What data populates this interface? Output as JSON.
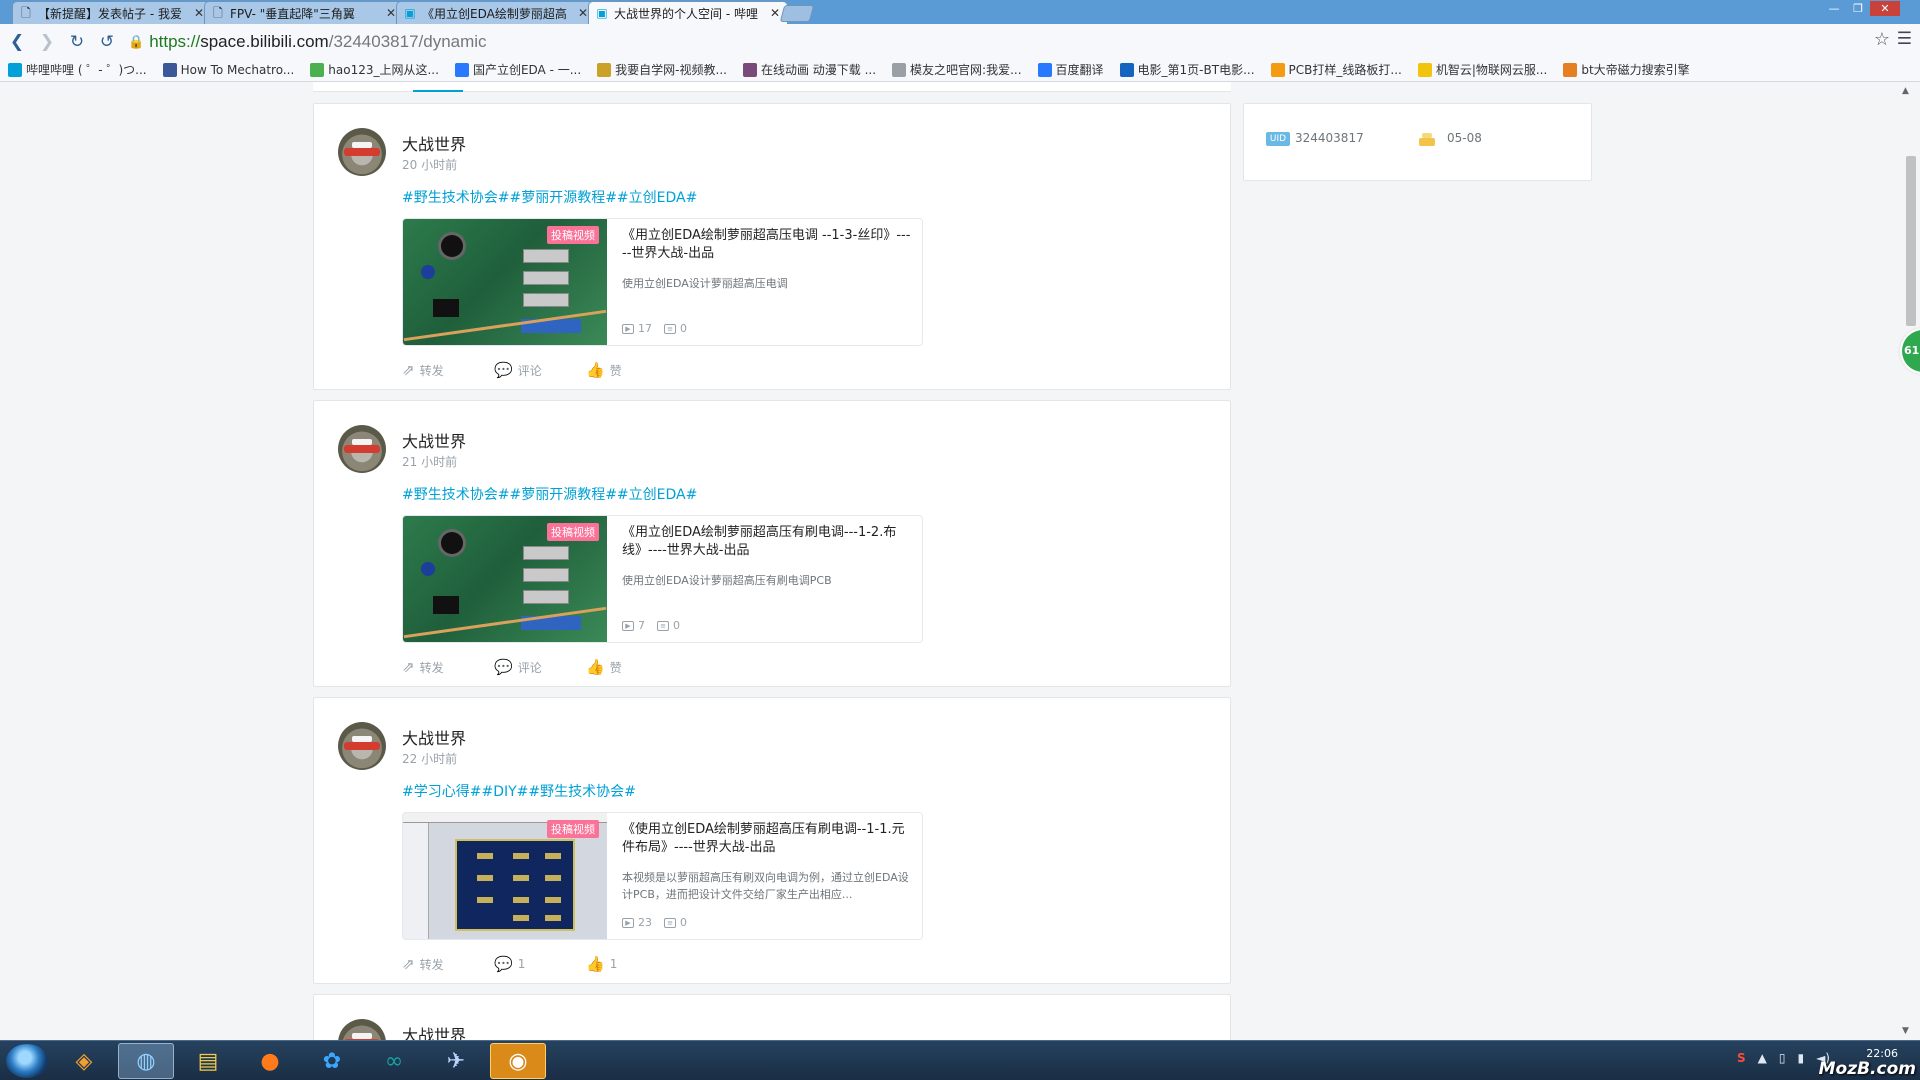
{
  "browser": {
    "tabs": [
      {
        "title": "【新提醒】发表帖子 - 我爱",
        "icon": "page-icon"
      },
      {
        "title": "FPV- \"垂直起降\"三角翼",
        "icon": "page-icon"
      },
      {
        "title": "《用立创EDA绘制萝丽超高",
        "icon": "bilibili-icon"
      },
      {
        "title": "大战世界的个人空间 - 哔哩",
        "icon": "bilibili-icon"
      }
    ],
    "url": {
      "protocol": "https://",
      "host": "space.bilibili.com",
      "path": "/324403817/dynamic"
    },
    "bookmarks": [
      {
        "label": "哔哩哔哩 ( ゜- ゜)つ...",
        "color": "#00a1d6"
      },
      {
        "label": "How To Mechatro...",
        "color": "#3b5998"
      },
      {
        "label": "hao123_上网从这...",
        "color": "#4caf50"
      },
      {
        "label": "国产立创EDA - 一...",
        "color": "#2979ff"
      },
      {
        "label": "我要自学网-视频教...",
        "color": "#c9a227"
      },
      {
        "label": "在线动画 动漫下载 ...",
        "color": "#7a4a7a"
      },
      {
        "label": "模友之吧官网:我爱...",
        "color": "#9aa0a6"
      },
      {
        "label": "百度翻译",
        "color": "#2979ff"
      },
      {
        "label": "电影_第1页-BT电影...",
        "color": "#1565c0"
      },
      {
        "label": "PCB打样_线路板打...",
        "color": "#f39c12"
      },
      {
        "label": "机智云|物联网云服...",
        "color": "#f1c40f"
      },
      {
        "label": "bt大帝磁力搜索引擎",
        "color": "#e67e22"
      }
    ]
  },
  "profile": {
    "uid": "324403817",
    "birthday": "05-08"
  },
  "posts": [
    {
      "user": "大战世界",
      "time": "20 小时前",
      "tags": "#野生技术协会##萝丽开源教程##立创EDA#",
      "video": {
        "badge": "投稿视频",
        "title": "《用立创EDA绘制萝丽超高压电调 --1-3-丝印》-----世界大战-出品",
        "desc": "使用立创EDA设计萝丽超高压电调",
        "plays": "17",
        "danmaku": "0"
      },
      "actions": {
        "share": "转发",
        "comment": "评论",
        "like": "赞"
      }
    },
    {
      "user": "大战世界",
      "time": "21 小时前",
      "tags": "#野生技术协会##萝丽开源教程##立创EDA#",
      "video": {
        "badge": "投稿视频",
        "title": "《用立创EDA绘制萝丽超高压有刷电调---1-2.布线》----世界大战-出品",
        "desc": "使用立创EDA设计萝丽超高压有刷电调PCB",
        "plays": "7",
        "danmaku": "0"
      },
      "actions": {
        "share": "转发",
        "comment": "评论",
        "like": "赞"
      }
    },
    {
      "user": "大战世界",
      "time": "22 小时前",
      "tags": "#学习心得##DIY##野生技术协会#",
      "video": {
        "badge": "投稿视频",
        "title": "《使用立创EDA绘制萝丽超高压有刷电调--1-1.元件布局》----世界大战-出品",
        "desc": "本视频是以萝丽超高压有刷双向电调为例，通过立创EDA设计PCB，进而把设计文件交给厂家生产出相应...",
        "plays": "23",
        "danmaku": "0"
      },
      "actions": {
        "share": "转发",
        "comment": "1",
        "like": "1"
      }
    },
    {
      "user": "大战世界"
    }
  ],
  "float_badge": "61",
  "taskbar": {
    "time": "22:06",
    "watermark": "MozB.com"
  }
}
